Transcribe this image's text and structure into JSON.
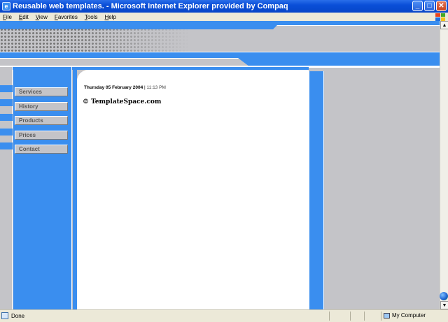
{
  "window": {
    "title": "Reusable web templates. - Microsoft Internet Explorer provided by Compaq",
    "icon_glyph": "e",
    "minimize_glyph": "_",
    "maximize_glyph": "□",
    "close_glyph": "✕"
  },
  "menu": {
    "items": [
      {
        "key": "F",
        "rest": "ile"
      },
      {
        "key": "E",
        "rest": "dit"
      },
      {
        "key": "V",
        "rest": "iew"
      },
      {
        "key": "F",
        "rest": "avorites"
      },
      {
        "key": "T",
        "rest": "ools"
      },
      {
        "key": "H",
        "rest": "elp"
      }
    ]
  },
  "nav": {
    "items": [
      "Services",
      "History",
      "Products",
      "Prices",
      "Contact"
    ]
  },
  "content": {
    "date": "Thursday 05 February 2004",
    "separator": "|",
    "time": "11:13 PM",
    "copyright": "© TemplateSpace.com"
  },
  "scrollbar": {
    "up_glyph": "▲",
    "down_glyph": "▼"
  },
  "status": {
    "left_text": "Done",
    "zone_text": "My Computer"
  },
  "colors": {
    "accent_blue": "#3a8eef",
    "panel_grey": "#c4c4c8",
    "titlebar_blue": "#0a4fd8"
  }
}
